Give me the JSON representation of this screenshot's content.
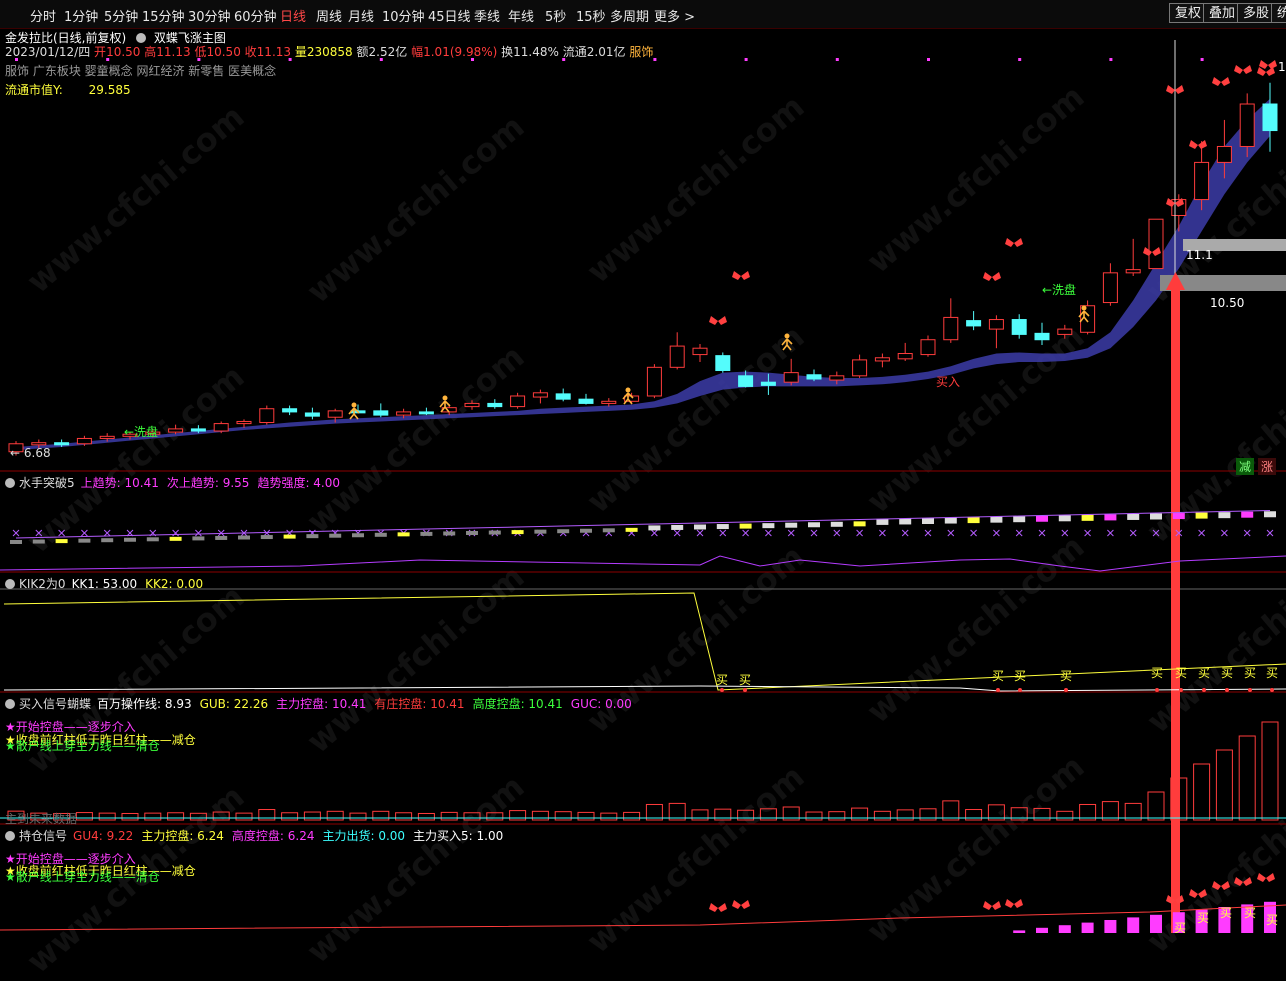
{
  "toolbar": {
    "tabs": [
      "分时",
      "1分钟",
      "5分钟",
      "15分钟",
      "30分钟",
      "60分钟",
      "日线",
      "周线",
      "月线",
      "10分钟",
      "45日线",
      "季线",
      "年线",
      "5秒",
      "15秒",
      "多周期",
      "更多 >"
    ],
    "active_tab": "日线",
    "right_buttons": [
      "复权",
      "叠加",
      "多股",
      "统"
    ]
  },
  "stock": {
    "title": "金发拉比(日线,前复权)",
    "formula": "双蝶飞涨主图",
    "date": "2023/01/12/四",
    "open_label": "开",
    "open": "10.50",
    "high_label": "高",
    "high": "11.13",
    "low_label": "低",
    "low": "10.50",
    "close_label": "收",
    "close": "11.13",
    "vol_label": "量",
    "vol": "230858",
    "amount_label": "额",
    "amount": "2.52亿",
    "chg_label": "幅",
    "chg": "1.01(9.98%)",
    "turnover_label": "换",
    "turnover": "11.48%",
    "float_label": "流通",
    "float": "2.01亿",
    "industry": "服饰",
    "concepts": "服饰 广东板块 婴童概念 网红经济 新零售 医美概念",
    "market_cap_label": "流通市值Y:",
    "market_cap": "29.585"
  },
  "main_chart": {
    "low_marker": "← 6.68",
    "wash1": "←洗盘",
    "wash2": "←洗盘",
    "buy": "买入",
    "price_label1": "11.1",
    "price_label2": "10.50",
    "reduce": "减",
    "rise": "涨",
    "edge_label": "1"
  },
  "panel1": {
    "name": "水手突破5",
    "items": [
      {
        "label": "上趋势:",
        "value": "10.41",
        "color": "#ff3cff"
      },
      {
        "label": "次上趋势:",
        "value": "9.55",
        "color": "#ff3cff"
      },
      {
        "label": "趋势强度:",
        "value": "4.00",
        "color": "#ff3cff"
      }
    ]
  },
  "panel2": {
    "name": "KIK2为0",
    "items": [
      {
        "label": "KK1:",
        "value": "53.00",
        "color": "#ffffff"
      },
      {
        "label": "KK2:",
        "value": "0.00",
        "color": "#ffff3c"
      }
    ],
    "buy_text": "买"
  },
  "panel3": {
    "name": "买入信号蝴蝶",
    "items": [
      {
        "label": "百万操作线:",
        "value": "8.93",
        "color": "#ffffff"
      },
      {
        "label": "GUB:",
        "value": "22.26",
        "color": "#ffff3c"
      },
      {
        "label": "主力控盘:",
        "value": "10.41",
        "color": "#ff3cff"
      },
      {
        "label": "有庄控盘:",
        "value": "10.41",
        "color": "#ff3c3c"
      },
      {
        "label": "高度控盘:",
        "value": "10.41",
        "color": "#3cff3c"
      },
      {
        "label": "GUC:",
        "value": "0.00",
        "color": "#ff3cff"
      }
    ],
    "legend1": "★开始控盘——逐步介入",
    "legend2": "★收盘前红柱低于昨日红柱——减仓",
    "legend3": "★散户线上穿主力线——清仓",
    "footer": "主到未来数据"
  },
  "panel4": {
    "name": "持仓信号",
    "items": [
      {
        "label": "GU4:",
        "value": "9.22",
        "color": "#ff3c3c"
      },
      {
        "label": "主力控盘:",
        "value": "6.24",
        "color": "#ffff3c"
      },
      {
        "label": "高度控盘:",
        "value": "6.24",
        "color": "#ff3cff"
      },
      {
        "label": "主力出货:",
        "value": "0.00",
        "color": "#3cffff"
      },
      {
        "label": "主力买入5:",
        "value": "1.00",
        "color": "#ffffff"
      }
    ],
    "legend1": "★开始控盘——逐步介入",
    "legend2": "★收盘前红柱低于昨日红柱——减仓",
    "legend3": "★散户线上穿主力线——清仓",
    "buy_text": "买"
  },
  "watermark": "www.cfchi.com",
  "colors": {
    "up": "#ff3c3c",
    "down": "#54fcfc",
    "band": "#3c3ca8",
    "bg": "#000000"
  },
  "candles": [
    {
      "o": 6.75,
      "h": 6.95,
      "l": 6.68,
      "c": 6.9
    },
    {
      "o": 6.88,
      "h": 6.98,
      "l": 6.82,
      "c": 6.92
    },
    {
      "o": 6.92,
      "h": 6.98,
      "l": 6.84,
      "c": 6.88
    },
    {
      "o": 6.9,
      "h": 7.05,
      "l": 6.86,
      "c": 7.0
    },
    {
      "o": 7.0,
      "h": 7.1,
      "l": 6.94,
      "c": 7.04
    },
    {
      "o": 7.04,
      "h": 7.12,
      "l": 6.98,
      "c": 7.08
    },
    {
      "o": 7.08,
      "h": 7.18,
      "l": 7.02,
      "c": 7.12
    },
    {
      "o": 7.12,
      "h": 7.26,
      "l": 7.08,
      "c": 7.18
    },
    {
      "o": 7.18,
      "h": 7.25,
      "l": 7.1,
      "c": 7.14
    },
    {
      "o": 7.14,
      "h": 7.32,
      "l": 7.1,
      "c": 7.28
    },
    {
      "o": 7.28,
      "h": 7.36,
      "l": 7.2,
      "c": 7.32
    },
    {
      "o": 7.3,
      "h": 7.62,
      "l": 7.26,
      "c": 7.56
    },
    {
      "o": 7.56,
      "h": 7.62,
      "l": 7.44,
      "c": 7.5
    },
    {
      "o": 7.48,
      "h": 7.58,
      "l": 7.36,
      "c": 7.42
    },
    {
      "o": 7.4,
      "h": 7.56,
      "l": 7.3,
      "c": 7.52
    },
    {
      "o": 7.52,
      "h": 7.64,
      "l": 7.48,
      "c": 7.5
    },
    {
      "o": 7.52,
      "h": 7.66,
      "l": 7.4,
      "c": 7.44
    },
    {
      "o": 7.44,
      "h": 7.56,
      "l": 7.38,
      "c": 7.5
    },
    {
      "o": 7.5,
      "h": 7.58,
      "l": 7.44,
      "c": 7.48
    },
    {
      "o": 7.5,
      "h": 7.64,
      "l": 7.44,
      "c": 7.58
    },
    {
      "o": 7.6,
      "h": 7.72,
      "l": 7.54,
      "c": 7.66
    },
    {
      "o": 7.66,
      "h": 7.74,
      "l": 7.56,
      "c": 7.6
    },
    {
      "o": 7.6,
      "h": 7.86,
      "l": 7.56,
      "c": 7.8
    },
    {
      "o": 7.78,
      "h": 7.92,
      "l": 7.66,
      "c": 7.86
    },
    {
      "o": 7.84,
      "h": 7.94,
      "l": 7.7,
      "c": 7.74
    },
    {
      "o": 7.74,
      "h": 7.84,
      "l": 7.64,
      "c": 7.66
    },
    {
      "o": 7.66,
      "h": 7.76,
      "l": 7.6,
      "c": 7.7
    },
    {
      "o": 7.7,
      "h": 7.86,
      "l": 7.66,
      "c": 7.8
    },
    {
      "o": 7.8,
      "h": 8.4,
      "l": 7.76,
      "c": 8.34
    },
    {
      "o": 8.34,
      "h": 9.0,
      "l": 8.3,
      "c": 8.74
    },
    {
      "o": 8.58,
      "h": 8.78,
      "l": 8.44,
      "c": 8.7
    },
    {
      "o": 8.56,
      "h": 8.62,
      "l": 8.24,
      "c": 8.28
    },
    {
      "o": 8.18,
      "h": 8.28,
      "l": 7.96,
      "c": 7.98
    },
    {
      "o": 8.06,
      "h": 8.22,
      "l": 7.82,
      "c": 8.0
    },
    {
      "o": 8.06,
      "h": 8.5,
      "l": 8.0,
      "c": 8.24
    },
    {
      "o": 8.2,
      "h": 8.3,
      "l": 8.08,
      "c": 8.12
    },
    {
      "o": 8.1,
      "h": 8.26,
      "l": 8.02,
      "c": 8.18
    },
    {
      "o": 8.18,
      "h": 8.58,
      "l": 8.14,
      "c": 8.48
    },
    {
      "o": 8.46,
      "h": 8.6,
      "l": 8.34,
      "c": 8.52
    },
    {
      "o": 8.5,
      "h": 8.8,
      "l": 8.46,
      "c": 8.6
    },
    {
      "o": 8.58,
      "h": 8.94,
      "l": 8.54,
      "c": 8.86
    },
    {
      "o": 8.86,
      "h": 9.64,
      "l": 8.8,
      "c": 9.28
    },
    {
      "o": 9.22,
      "h": 9.4,
      "l": 9.04,
      "c": 9.12
    },
    {
      "o": 9.06,
      "h": 9.32,
      "l": 8.7,
      "c": 9.24
    },
    {
      "o": 9.24,
      "h": 9.34,
      "l": 8.88,
      "c": 8.96
    },
    {
      "o": 8.98,
      "h": 9.18,
      "l": 8.76,
      "c": 8.86
    },
    {
      "o": 8.96,
      "h": 9.14,
      "l": 8.88,
      "c": 9.06
    },
    {
      "o": 9.0,
      "h": 9.6,
      "l": 8.96,
      "c": 9.5
    },
    {
      "o": 9.56,
      "h": 10.3,
      "l": 9.5,
      "c": 10.12
    },
    {
      "o": 10.12,
      "h": 10.76,
      "l": 10.06,
      "c": 10.18
    },
    {
      "o": 10.2,
      "h": 11.13,
      "l": 10.5,
      "c": 11.13
    },
    {
      "o": 11.2,
      "h": 11.6,
      "l": 10.9,
      "c": 11.5
    },
    {
      "o": 11.5,
      "h": 12.6,
      "l": 11.3,
      "c": 12.2
    },
    {
      "o": 12.2,
      "h": 13.0,
      "l": 11.9,
      "c": 12.5
    },
    {
      "o": 12.5,
      "h": 13.5,
      "l": 12.3,
      "c": 13.3
    },
    {
      "o": 13.3,
      "h": 13.7,
      "l": 12.4,
      "c": 12.8
    }
  ],
  "band_upper": [
    6.84,
    6.87,
    6.9,
    6.94,
    6.98,
    7.02,
    7.06,
    7.1,
    7.14,
    7.18,
    7.22,
    7.26,
    7.3,
    7.33,
    7.36,
    7.38,
    7.4,
    7.42,
    7.44,
    7.46,
    7.48,
    7.5,
    7.52,
    7.56,
    7.58,
    7.6,
    7.62,
    7.64,
    7.7,
    7.84,
    8.08,
    8.24,
    8.26,
    8.24,
    8.2,
    8.16,
    8.14,
    8.14,
    8.16,
    8.2,
    8.26,
    8.36,
    8.5,
    8.6,
    8.62,
    8.6,
    8.6,
    8.7,
    9.0,
    9.6,
    10.3,
    11.0,
    11.8,
    12.5,
    13.0,
    13.4
  ],
  "band_lower": [
    6.78,
    6.81,
    6.84,
    6.88,
    6.92,
    6.96,
    7.0,
    7.04,
    7.08,
    7.12,
    7.16,
    7.19,
    7.22,
    7.25,
    7.28,
    7.3,
    7.32,
    7.34,
    7.36,
    7.38,
    7.4,
    7.42,
    7.44,
    7.46,
    7.48,
    7.5,
    7.52,
    7.54,
    7.58,
    7.66,
    7.8,
    7.92,
    7.96,
    7.98,
    7.98,
    7.98,
    7.98,
    8.0,
    8.02,
    8.06,
    8.12,
    8.2,
    8.32,
    8.4,
    8.44,
    8.44,
    8.46,
    8.52,
    8.7,
    9.1,
    9.6,
    10.2,
    10.9,
    11.6,
    12.2,
    12.7
  ]
}
